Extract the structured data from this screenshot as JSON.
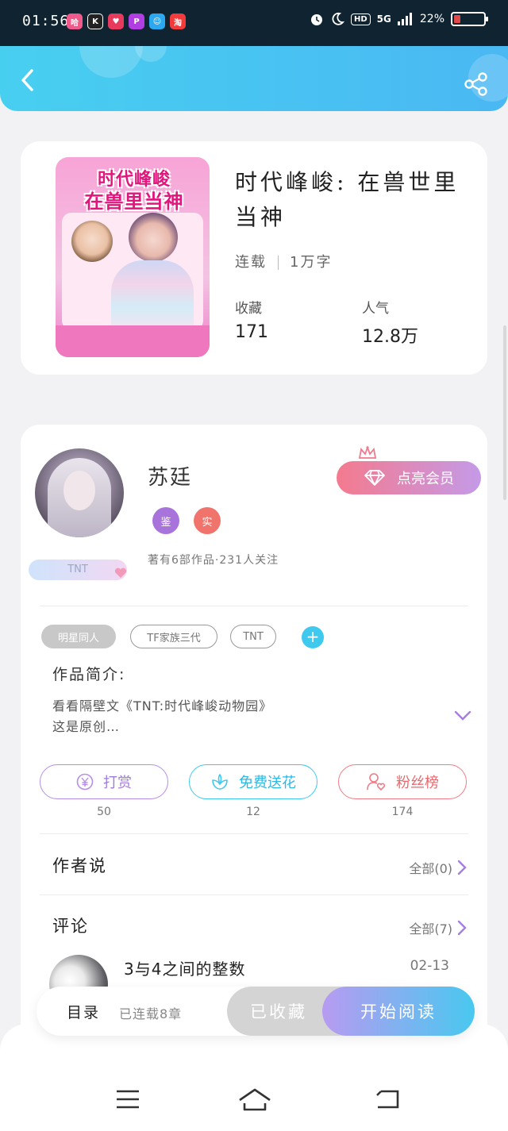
{
  "status_bar": {
    "time": "01:56",
    "apps": [
      {
        "label": "哈",
        "color": "#f05a8a"
      },
      {
        "label": "K",
        "color": "#222222"
      },
      {
        "label": "♥",
        "color": "#e83a5c"
      },
      {
        "label": "P",
        "color": "#b13ee0"
      },
      {
        "label": "☺",
        "color": "#2ba8f0"
      },
      {
        "label": "淘",
        "color": "#f33b3b"
      }
    ],
    "hd": "HD",
    "network": "5G",
    "battery_text": "22%",
    "battery_level": 0.22,
    "battery_color": "#e04a4a"
  },
  "header": {
    "back_icon": "back-arrow-icon",
    "share_icon": "share-icon",
    "gradient_start": "#47cff0",
    "gradient_end": "#4ab8f3"
  },
  "book": {
    "cover_title_line1": "时代峰峻",
    "cover_title_line2": "在兽里当神",
    "title": "时代峰峻: 在兽世里当神",
    "status": "连载",
    "word_count": "1万字",
    "favorites_label": "收藏",
    "favorites_value": "171",
    "popularity_label": "人气",
    "popularity_value": "12.8万"
  },
  "author": {
    "name": "苏廷",
    "badge_tnt": "TNT",
    "vip_button": "点亮会员",
    "badge_1": "鉴",
    "badge_2": "实",
    "meta": "著有6部作品·231人关注"
  },
  "tags": {
    "items": [
      "明星同人",
      "TF家族三代",
      "TNT"
    ],
    "add_label": "+"
  },
  "intro": {
    "title": "作品简介:",
    "line1": "看看隔壁文《TNT:时代峰峻动物园》",
    "line2": "这是原创…"
  },
  "actions": {
    "reward_label": "打赏",
    "reward_count": "50",
    "flower_label": "免费送花",
    "flower_count": "12",
    "fans_label": "粉丝榜",
    "fans_count": "174",
    "reward_color": "#b58ee8",
    "flower_color": "#3fc9ef",
    "fans_color": "#f07a86"
  },
  "author_says": {
    "title": "作者说",
    "link": "全部(0)"
  },
  "comments": {
    "title": "评论",
    "link": "全部(7)",
    "first_text": "3与4之间的整数",
    "first_date": "02-13"
  },
  "bottom_bar": {
    "toc_label": "目录",
    "toc_sub": "已连载8章",
    "collected_label": "已收藏",
    "read_label": "开始阅读"
  },
  "nav": {
    "menu_icon": "menu-icon",
    "home_icon": "home-icon",
    "back_icon": "back-nav-icon"
  }
}
